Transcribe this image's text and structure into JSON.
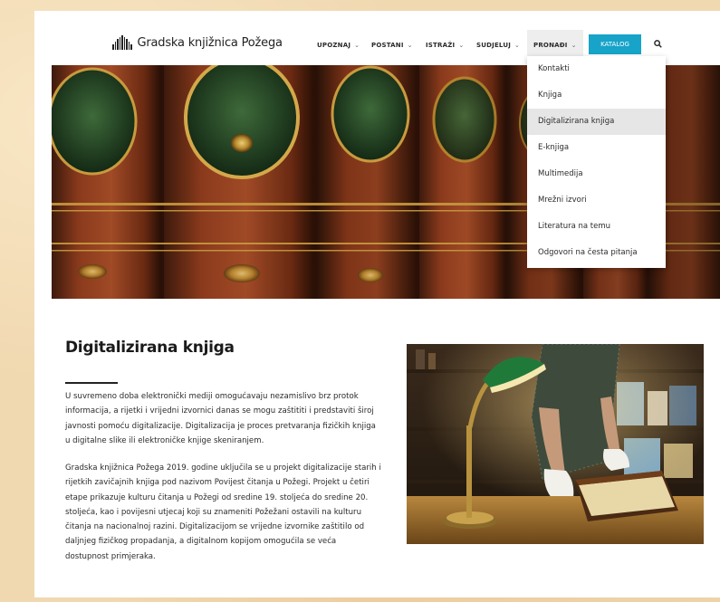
{
  "site": {
    "name": "Gradska knjižnica Požega"
  },
  "nav": {
    "items": [
      {
        "label": "UPOZNAJ"
      },
      {
        "label": "POSTANI"
      },
      {
        "label": "ISTRAŽI"
      },
      {
        "label": "SUDJELUJ"
      },
      {
        "label": "PRONAĐI"
      }
    ],
    "active_index": 4,
    "katalog_label": "KATALOG",
    "search_icon": "search-icon"
  },
  "dropdown": {
    "items": [
      {
        "label": "Kontakti"
      },
      {
        "label": "Knjiga"
      },
      {
        "label": "Digitalizirana knjiga"
      },
      {
        "label": "E-knjiga"
      },
      {
        "label": "Multimedija"
      },
      {
        "label": "Mrežni izvori"
      },
      {
        "label": "Literatura na temu"
      },
      {
        "label": "Odgovori na česta pitanja"
      }
    ],
    "active_index": 2
  },
  "article": {
    "title": "Digitalizirana knjiga",
    "paragraph1_lines": [
      "U suvremeno doba elektronički mediji omogućavaju nezamislivo brz protok",
      "informacija, a rijetki i vrijedni izvornici danas se mogu zaštititi i predstaviti široj",
      "javnosti pomoću digitalizacije. Digitalizacija je proces pretvaranja fizičkih knjiga",
      "u digitalne slike ili elektroničke knjige skeniranjem."
    ],
    "paragraph2_lines": [
      "Gradska knjižnica Požega 2019. godine uključila se u projekt digitalizacije starih i",
      "rijetkih zavičajnih knjiga pod nazivom Povijest čitanja u Požegi. Projekt u četiri",
      "etape prikazuje kulturu čitanja u Požegi od sredine 19. stoljeća do sredine 20.",
      "stoljeća, kao i povijesni utjecaj koji su znameniti Požežani ostavili na kulturu",
      "čitanja na nacionalnoj razini. Digitalizacijom se vrijedne izvornike zaštitilo od",
      "daljnjeg fizičkog propadanja, a digitalnom kopijom omogućila se veća",
      "dostupnost primjeraka."
    ]
  },
  "colors": {
    "accent": "#18a3c9",
    "text": "#2b2b2b",
    "page_bg": "#f0d8b0"
  }
}
